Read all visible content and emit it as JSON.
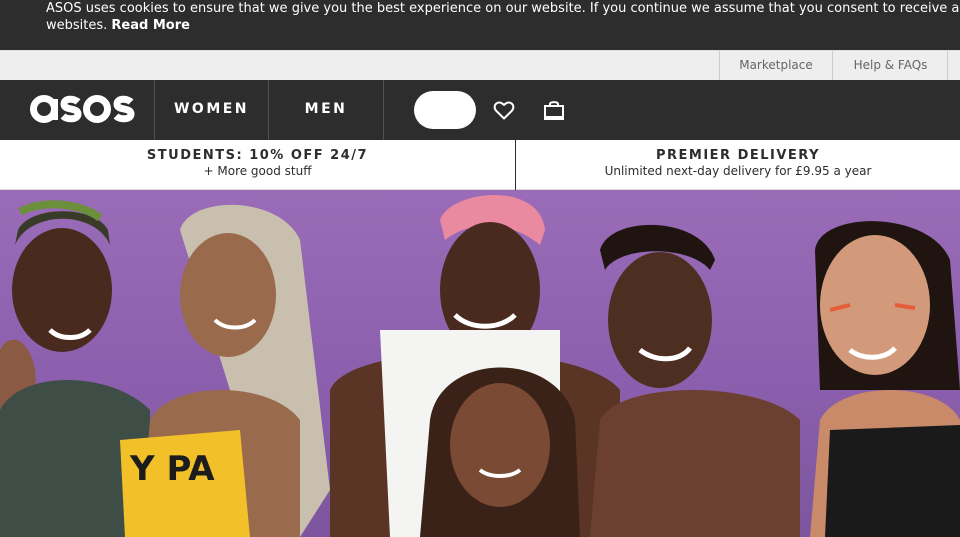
{
  "cookie_banner": {
    "line1": "ASOS uses cookies to ensure that we give you the best experience on our website. If you continue we assume that you consent to receive all cookies on all ASOS",
    "line2_text": "websites.",
    "read_more": "Read More"
  },
  "utility_bar": {
    "marketplace": "Marketplace",
    "help": "Help & FAQs"
  },
  "nav": {
    "logo": "asos",
    "tabs": [
      {
        "label": "WOMEN"
      },
      {
        "label": "MEN"
      }
    ],
    "search_placeholder": "",
    "icons": [
      "heart-icon",
      "bag-icon"
    ]
  },
  "promo": {
    "left": {
      "title": "STUDENTS: 10% OFF 24/7",
      "subtitle": "+ More good stuff"
    },
    "right": {
      "title": "PREMIER DELIVERY",
      "subtitle": "Unlimited next-day delivery for £9.95 a year"
    }
  },
  "hero": {
    "shirt_text": "Y PA",
    "colors": {
      "background": "#8b5fad",
      "nav": "#2d2d2d"
    }
  }
}
